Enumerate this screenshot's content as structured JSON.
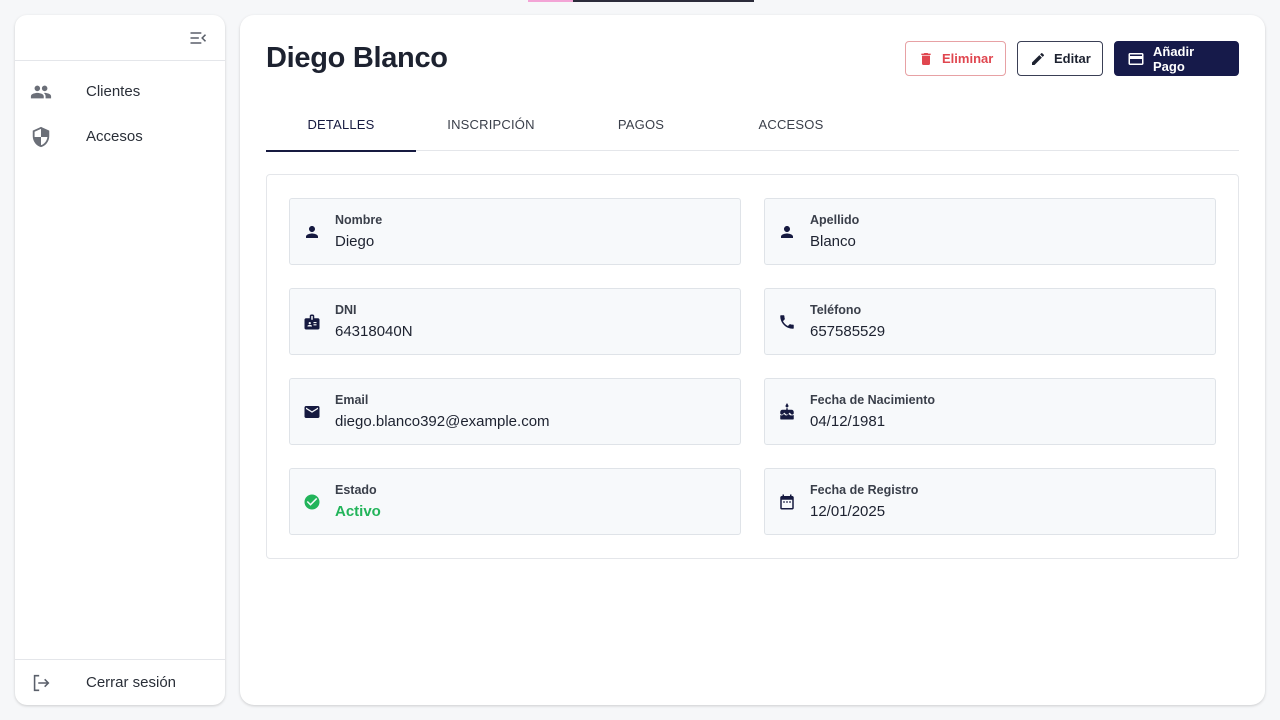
{
  "sidebar": {
    "items": [
      {
        "label": "Clientes",
        "icon": "people-icon"
      },
      {
        "label": "Accesos",
        "icon": "shield-icon"
      }
    ],
    "logout_label": "Cerrar sesión"
  },
  "header": {
    "title": "Diego Blanco",
    "actions": {
      "delete_label": "Eliminar",
      "edit_label": "Editar",
      "add_payment_label": "Añadir Pago"
    }
  },
  "tabs": [
    {
      "label": "DETALLES",
      "active": true
    },
    {
      "label": "INSCRIPCIÓN",
      "active": false
    },
    {
      "label": "PAGOS",
      "active": false
    },
    {
      "label": "ACCESOS",
      "active": false
    }
  ],
  "details": {
    "nombre": {
      "label": "Nombre",
      "value": "Diego"
    },
    "apellido": {
      "label": "Apellido",
      "value": "Blanco"
    },
    "dni": {
      "label": "DNI",
      "value": "64318040N"
    },
    "telefono": {
      "label": "Teléfono",
      "value": "657585529"
    },
    "email": {
      "label": "Email",
      "value": "diego.blanco392@example.com"
    },
    "nacimiento": {
      "label": "Fecha de Nacimiento",
      "value": "04/12/1981"
    },
    "estado": {
      "label": "Estado",
      "value": "Activo"
    },
    "registro": {
      "label": "Fecha de Registro",
      "value": "12/01/2025"
    }
  },
  "colors": {
    "brand": "#161a4a",
    "danger": "#e0464f",
    "success": "#22b45a"
  }
}
